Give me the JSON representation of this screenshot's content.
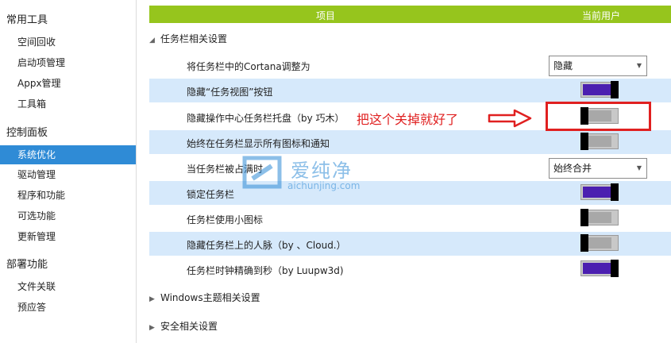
{
  "sidebar": {
    "sections": [
      {
        "title": "常用工具",
        "items": [
          "空间回收",
          "启动项管理",
          "Appx管理",
          "工具箱"
        ]
      },
      {
        "title": "控制面板",
        "items": [
          "系统优化",
          "驱动管理",
          "程序和功能",
          "可选功能",
          "更新管理"
        ]
      },
      {
        "title": "部署功能",
        "items": [
          "文件关联",
          "预应答"
        ]
      }
    ],
    "active_item": "系统优化"
  },
  "table_header": {
    "col_item": "项目",
    "col_user": "当前用户"
  },
  "groups": {
    "taskbar": "任务栏相关设置",
    "windows_theme": "Windows主题相关设置",
    "security": "安全相关设置"
  },
  "rows": [
    {
      "label": "将任务栏中的Cortana调整为",
      "type": "select",
      "value": "隐藏"
    },
    {
      "label": "隐藏“任务视图”按钮",
      "type": "toggle",
      "on": true
    },
    {
      "label": "隐藏操作中心任务栏托盘（by 巧木）",
      "type": "toggle",
      "on": false
    },
    {
      "label": "始终在任务栏显示所有图标和通知",
      "type": "toggle",
      "on": false
    },
    {
      "label": "当任务栏被占满时",
      "type": "select",
      "value": "始终合并"
    },
    {
      "label": "锁定任务栏",
      "type": "toggle",
      "on": true
    },
    {
      "label": "任务栏使用小图标",
      "type": "toggle",
      "on": false
    },
    {
      "label": "隐藏任务栏上的人脉（by 、Cloud.）",
      "type": "toggle",
      "on": false
    },
    {
      "label": "任务栏时钟精确到秒（by Luupw3d)",
      "type": "toggle",
      "on": true
    }
  ],
  "annotation": {
    "text": "把这个关掉就好了"
  },
  "watermark": {
    "name": "爱纯净",
    "url": "aichunjing.com"
  },
  "colors": {
    "header_green": "#96c51d",
    "active_blue": "#2f8bd6",
    "alt_row": "#d6e9fb",
    "toggle_on": "#4b1fb0",
    "annotation_red": "#e02020"
  }
}
